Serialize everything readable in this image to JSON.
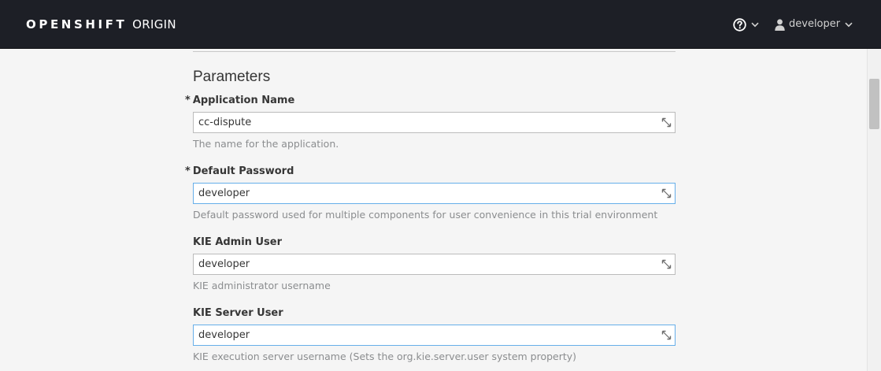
{
  "header": {
    "brand_strong": "OPENSHIFT",
    "brand_light": "ORIGIN",
    "help_icon": "question-circle-icon",
    "user_icon": "user-icon",
    "username": "developer"
  },
  "form": {
    "section_title": "Parameters",
    "fields": [
      {
        "label": "Application Name",
        "required": "*",
        "value": "cc-dispute",
        "help": "The name for the application."
      },
      {
        "label": "Default Password",
        "required": "*",
        "value": "developer",
        "help": "Default password used for multiple components for user convenience in this trial environment"
      },
      {
        "label": "KIE Admin User",
        "value": "developer",
        "help": "KIE administrator username"
      },
      {
        "label": "KIE Server User",
        "value": "developer",
        "help": "KIE execution server username (Sets the org.kie.server.user system property)"
      }
    ]
  },
  "colors": {
    "topbar_bg": "#1d1f26",
    "page_bg": "#f5f5f5",
    "focus_border": "#66afe9",
    "label_text": "#363636",
    "help_text": "#8b8d8f"
  }
}
